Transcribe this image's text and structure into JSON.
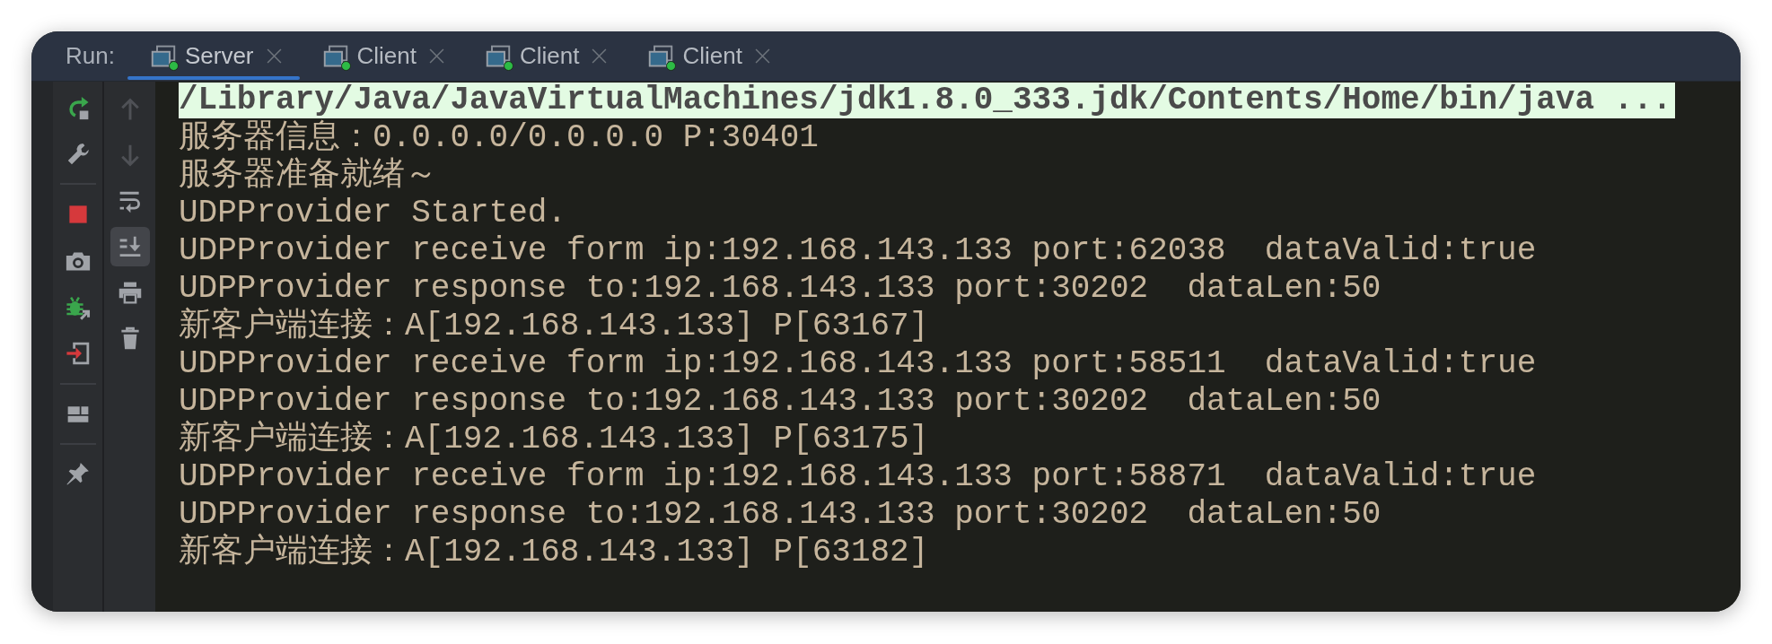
{
  "run_panel": {
    "label": "Run:",
    "tabs": [
      {
        "label": "Server",
        "selected": true,
        "running": true
      },
      {
        "label": "Client",
        "selected": false,
        "running": true
      },
      {
        "label": "Client",
        "selected": false,
        "running": true
      },
      {
        "label": "Client",
        "selected": false,
        "running": true
      }
    ]
  },
  "toolbar": {
    "secondary": [
      {
        "disabled": true,
        "toggled": false
      },
      {
        "disabled": true,
        "toggled": false
      },
      {
        "disabled": false,
        "toggled": false
      },
      {
        "disabled": false,
        "toggled": true
      },
      {
        "disabled": false,
        "toggled": false
      },
      {
        "disabled": false,
        "toggled": false
      }
    ]
  },
  "console": {
    "lines": [
      {
        "kind": "command",
        "text": "/Library/Java/JavaVirtualMachines/jdk1.8.0_333.jdk/Contents/Home/bin/java ..."
      },
      {
        "kind": "output",
        "text": "服务器信息：0.0.0.0/0.0.0.0 P:30401"
      },
      {
        "kind": "output",
        "text": "服务器准备就绪～"
      },
      {
        "kind": "output",
        "text": "UDPProvider Started."
      },
      {
        "kind": "output",
        "text": "UDPProvider receive form ip:192.168.143.133 port:62038  dataValid:true"
      },
      {
        "kind": "output",
        "text": "UDPProvider response to:192.168.143.133 port:30202  dataLen:50"
      },
      {
        "kind": "output",
        "text": "新客户端连接：A[192.168.143.133] P[63167]"
      },
      {
        "kind": "output",
        "text": "UDPProvider receive form ip:192.168.143.133 port:58511  dataValid:true"
      },
      {
        "kind": "output",
        "text": "UDPProvider response to:192.168.143.133 port:30202  dataLen:50"
      },
      {
        "kind": "output",
        "text": "新客户端连接：A[192.168.143.133] P[63175]"
      },
      {
        "kind": "output",
        "text": "UDPProvider receive form ip:192.168.143.133 port:58871  dataValid:true"
      },
      {
        "kind": "output",
        "text": "UDPProvider response to:192.168.143.133 port:30202  dataLen:50"
      },
      {
        "kind": "output",
        "text": "新客户端连接：A[192.168.143.133] P[63182]"
      }
    ]
  }
}
